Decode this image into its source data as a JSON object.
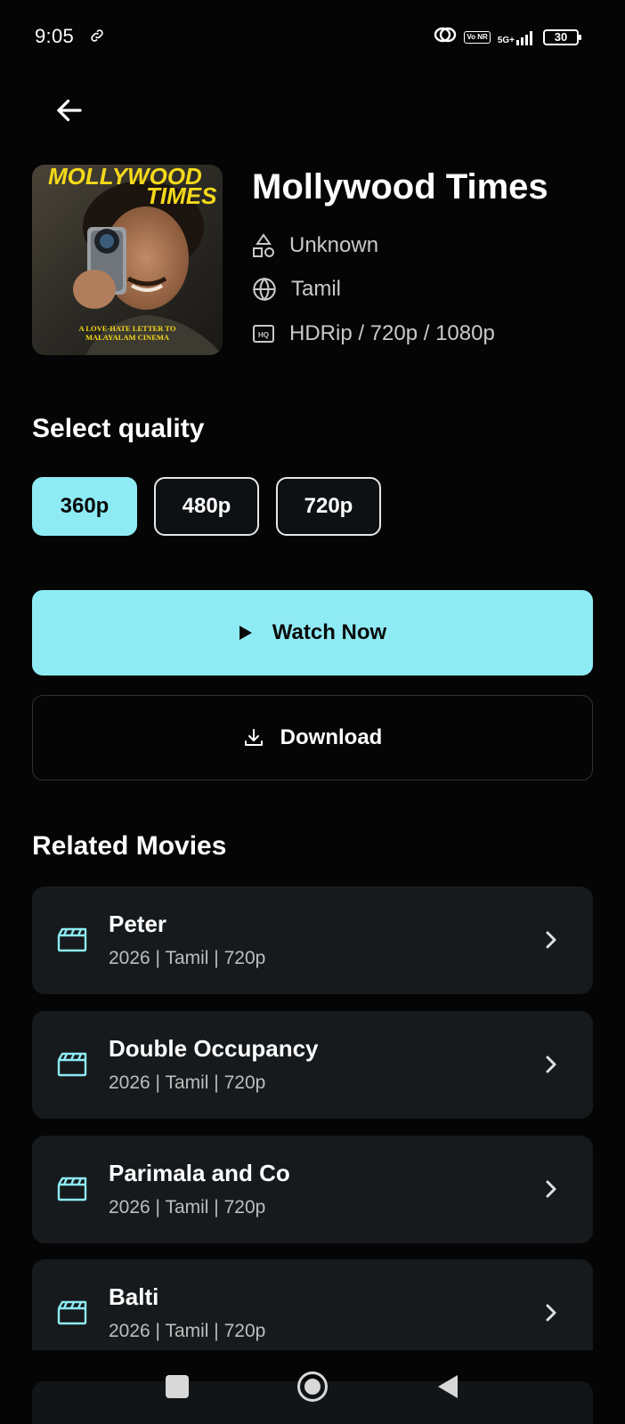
{
  "status_bar": {
    "time": "9:05",
    "network_top": "5G+",
    "network_bottom": "Vo NR",
    "battery": "30"
  },
  "movie": {
    "title": "Mollywood Times",
    "director": "Unknown",
    "language": "Tamil",
    "formats": "HDRip / 720p / 1080p",
    "poster": {
      "title_line1": "MOLLYWOOD",
      "title_line2": "TIMES",
      "tagline_line1": "A LOVE-HATE LETTER TO",
      "tagline_line2": "MALAYALAM CINEMA"
    }
  },
  "quality": {
    "section_title": "Select quality",
    "options": [
      "360p",
      "480p",
      "720p"
    ],
    "selected": "360p"
  },
  "actions": {
    "watch_label": "Watch Now",
    "download_label": "Download"
  },
  "related": {
    "section_title": "Related Movies",
    "items": [
      {
        "title": "Peter",
        "subtitle": "2026 | Tamil | 720p"
      },
      {
        "title": "Double Occupancy",
        "subtitle": "2026 | Tamil | 720p"
      },
      {
        "title": "Parimala and Co",
        "subtitle": "2026 | Tamil | 720p"
      },
      {
        "title": "Balti",
        "subtitle": "2026 | Tamil | 720p"
      }
    ]
  },
  "colors": {
    "accent": "#8eebf4",
    "background": "#050505",
    "card": "#161a1d"
  },
  "icons": {
    "back": "arrow-left-icon",
    "director": "shapes-icon",
    "language": "globe-icon",
    "format": "hd-icon",
    "watch": "play-icon",
    "download": "download-icon",
    "related_item": "clapperboard-icon",
    "related_chevron": "chevron-right-icon"
  }
}
